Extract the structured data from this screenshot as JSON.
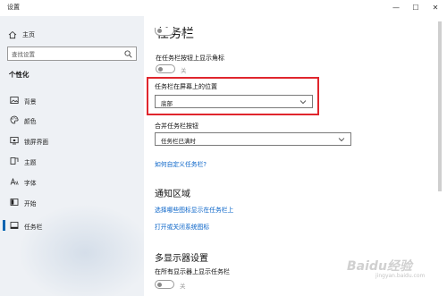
{
  "window": {
    "title": "设置",
    "controls": {
      "minimize": "—",
      "maximize": "☐",
      "close": "✕"
    }
  },
  "sidebar": {
    "home_label": "主页",
    "search_placeholder": "查找设置",
    "section_heading": "个性化",
    "items": [
      {
        "label": "背景",
        "icon": "picture-icon"
      },
      {
        "label": "颜色",
        "icon": "palette-icon"
      },
      {
        "label": "锁屏界面",
        "icon": "lock-screen-icon"
      },
      {
        "label": "主题",
        "icon": "brush-icon"
      },
      {
        "label": "字体",
        "icon": "font-icon"
      },
      {
        "label": "开始",
        "icon": "start-icon"
      },
      {
        "label": "任务栏",
        "icon": "taskbar-icon",
        "active": true
      }
    ]
  },
  "main": {
    "page_title": "任务栏",
    "top_toggle_label": "关",
    "badges_setting_label": "在任务栏按钮上显示角标",
    "badges_toggle_state": "关",
    "location_label": "任务栏在屏幕上的位置",
    "location_value": "底部",
    "combine_label": "合并任务栏按钮",
    "combine_value": "任务栏已满时",
    "customize_link": "如何自定义任务栏?",
    "notification_heading": "通知区域",
    "notification_link_1": "选择哪些图标显示在任务栏上",
    "notification_link_2": "打开或关闭系统图标",
    "multi_display_heading": "多显示器设置",
    "multi_display_setting_label": "在所有显示器上显示任务栏",
    "multi_display_toggle_state": "关"
  },
  "overlay": {
    "watermark": "Baidu经验",
    "watermark_sub": "jingyan.baidu.com",
    "highlight_color": "#e0262d"
  },
  "colors": {
    "accent": "#0063b1",
    "link": "#0a64c8",
    "sidebar_bg": "#eef1f5"
  }
}
